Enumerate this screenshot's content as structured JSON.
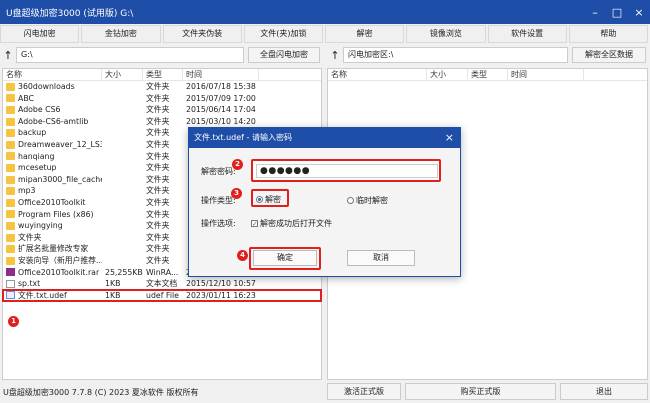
{
  "window": {
    "title": "U盘超级加密3000 (试用版)   G:\\"
  },
  "toolbar": [
    "闪电加密",
    "金钻加密",
    "文件夹伪装",
    "文件(夹)加锁",
    "解密",
    "镜像浏览",
    "软件设置",
    "帮助"
  ],
  "left_path": {
    "value": "G:\\",
    "button": "全盘闪电加密"
  },
  "right_path": {
    "value": "闪电加密区:\\",
    "button": "解密全区数据"
  },
  "columns": {
    "name": "名称",
    "size": "大小",
    "type": "类型",
    "time": "时间"
  },
  "files": [
    {
      "name": "360downloads",
      "size": "",
      "type": "文件夹",
      "time": "2016/07/18 15:38",
      "icon": "folder"
    },
    {
      "name": "ABC",
      "size": "",
      "type": "文件夹",
      "time": "2015/07/09 17:00",
      "icon": "folder"
    },
    {
      "name": "Adobe CS6",
      "size": "",
      "type": "文件夹",
      "time": "2015/06/14 17:04",
      "icon": "folder"
    },
    {
      "name": "Adobe-CS6-amtlib",
      "size": "",
      "type": "文件夹",
      "time": "2015/03/10 14:20",
      "icon": "folder"
    },
    {
      "name": "backup",
      "size": "",
      "type": "文件夹",
      "time": "",
      "icon": "folder"
    },
    {
      "name": "Dreamweaver_12_LS3",
      "size": "",
      "type": "文件夹",
      "time": "",
      "icon": "folder"
    },
    {
      "name": "hanqiang",
      "size": "",
      "type": "文件夹",
      "time": "",
      "icon": "folder"
    },
    {
      "name": "mcesetup",
      "size": "",
      "type": "文件夹",
      "time": "",
      "icon": "folder"
    },
    {
      "name": "mipan3000_file_cache",
      "size": "",
      "type": "文件夹",
      "time": "",
      "icon": "folder"
    },
    {
      "name": "mp3",
      "size": "",
      "type": "文件夹",
      "time": "",
      "icon": "folder"
    },
    {
      "name": "Office2010Toolkit",
      "size": "",
      "type": "文件夹",
      "time": "",
      "icon": "folder"
    },
    {
      "name": "Program Files (x86)",
      "size": "",
      "type": "文件夹",
      "time": "",
      "icon": "folder"
    },
    {
      "name": "wuyingying",
      "size": "",
      "type": "文件夹",
      "time": "",
      "icon": "folder"
    },
    {
      "name": "文件夹",
      "size": "",
      "type": "文件夹",
      "time": "",
      "icon": "folder"
    },
    {
      "name": "扩展名批量修改专家",
      "size": "",
      "type": "文件夹",
      "time": "",
      "icon": "folder"
    },
    {
      "name": "安装向导（新用户推荐...",
      "size": "",
      "type": "文件夹",
      "time": "",
      "icon": "folder"
    },
    {
      "name": "Office2010Toolkit.rar",
      "size": "25,255KB",
      "type": "WinRA...",
      "time": "2014/04/18 11:25",
      "icon": "rar"
    },
    {
      "name": "sp.txt",
      "size": "1KB",
      "type": "文本文档",
      "time": "2015/12/10 10:57",
      "icon": "file"
    },
    {
      "name": "文件.txt.udef",
      "size": "1KB",
      "type": "udef File",
      "time": "2023/01/11 16:23",
      "icon": "udef",
      "selected": true
    }
  ],
  "status": {
    "text": "U盘超级加密3000 7.7.8 (C) 2023 夏冰软件 版权所有",
    "activate": "激活正式版",
    "buy": "购买正式版",
    "exit": "退出"
  },
  "dialog": {
    "title": "文件.txt.udef - 请输入密码",
    "password_label": "解密密码:",
    "password_value": "●●●●●●",
    "op_type_label": "操作类型:",
    "op_decrypt": "解密",
    "op_temp": "临时解密",
    "op_option_label": "操作选项:",
    "open_after": "解密成功后打开文件",
    "ok": "确定",
    "cancel": "取消"
  },
  "badges": [
    "1",
    "2",
    "3",
    "4"
  ],
  "colors": {
    "accent": "#1e4ea8",
    "annotation": "#e0201e"
  }
}
